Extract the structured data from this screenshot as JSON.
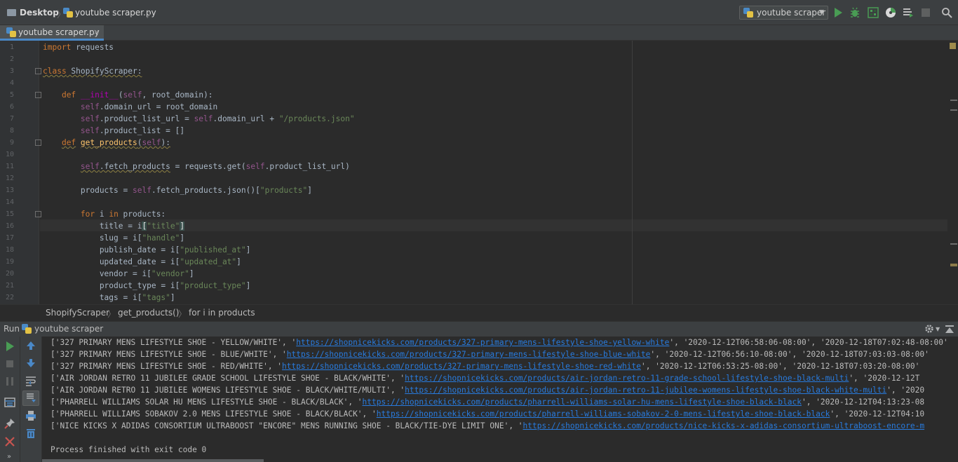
{
  "navbar": {
    "crumbs": [
      "Desktop",
      "youtube scraper.py"
    ],
    "run_config": "youtube scraper",
    "icons": [
      "run-icon",
      "debug-icon",
      "coverage-icon",
      "profile-icon",
      "concurrency-icon",
      "stop-icon",
      "search-icon"
    ]
  },
  "editor_tab": {
    "label": "youtube scraper.py",
    "close": "×"
  },
  "code": {
    "line_numbers": [
      "1",
      "2",
      "3",
      "4",
      "5",
      "6",
      "7",
      "8",
      "9",
      "10",
      "11",
      "12",
      "13",
      "14",
      "15",
      "16",
      "17",
      "18",
      "19",
      "20",
      "21",
      "22"
    ],
    "lines": [
      [
        {
          "t": "import",
          "c": "k"
        },
        {
          "t": " requests"
        }
      ],
      [],
      [
        {
          "t": "class",
          "c": "k wv"
        },
        {
          "t": " ShopifyScraper:",
          "c": "wv"
        }
      ],
      [],
      [
        {
          "t": "    "
        },
        {
          "t": "def",
          "c": "k"
        },
        {
          "t": " "
        },
        {
          "t": "__init__",
          "c": "m"
        },
        {
          "t": "("
        },
        {
          "t": "self",
          "c": "sf"
        },
        {
          "t": ", root_domain):"
        }
      ],
      [
        {
          "t": "        "
        },
        {
          "t": "self",
          "c": "sf"
        },
        {
          "t": ".domain_url = root_domain"
        }
      ],
      [
        {
          "t": "        "
        },
        {
          "t": "self",
          "c": "sf"
        },
        {
          "t": ".product_list_url = "
        },
        {
          "t": "self",
          "c": "sf"
        },
        {
          "t": ".domain_url + "
        },
        {
          "t": "\"/products.json\"",
          "c": "s"
        }
      ],
      [
        {
          "t": "        "
        },
        {
          "t": "self",
          "c": "sf"
        },
        {
          "t": ".product_list = []"
        }
      ],
      [
        {
          "t": "    "
        },
        {
          "t": "def",
          "c": "k wv"
        },
        {
          "t": " "
        },
        {
          "t": "get_products",
          "c": "fn wv"
        },
        {
          "t": "(",
          "c": "wv"
        },
        {
          "t": "self",
          "c": "sf wv"
        },
        {
          "t": "):",
          "c": "wv"
        }
      ],
      [],
      [
        {
          "t": "        "
        },
        {
          "t": "self",
          "c": "sf wv"
        },
        {
          "t": ".fetch_products",
          "c": "wv"
        },
        {
          "t": " = requests.get("
        },
        {
          "t": "self",
          "c": "sf"
        },
        {
          "t": ".product_list_url)"
        }
      ],
      [],
      [
        {
          "t": "        products = "
        },
        {
          "t": "self",
          "c": "sf"
        },
        {
          "t": ".fetch_products.json()["
        },
        {
          "t": "\"products\"",
          "c": "s"
        },
        {
          "t": "]"
        }
      ],
      [],
      [
        {
          "t": "        "
        },
        {
          "t": "for",
          "c": "k"
        },
        {
          "t": " i "
        },
        {
          "t": "in",
          "c": "k"
        },
        {
          "t": " products:"
        }
      ],
      [
        {
          "t": "            title = i"
        },
        {
          "t": "[",
          "c": "bm"
        },
        {
          "t": "\"title\"",
          "c": "s"
        },
        {
          "t": "]",
          "c": "bm"
        }
      ],
      [
        {
          "t": "            slug = i["
        },
        {
          "t": "\"handle\"",
          "c": "s"
        },
        {
          "t": "]"
        }
      ],
      [
        {
          "t": "            publish_date = i["
        },
        {
          "t": "\"published_at\"",
          "c": "s"
        },
        {
          "t": "]"
        }
      ],
      [
        {
          "t": "            updated_date = i["
        },
        {
          "t": "\"updated_at\"",
          "c": "s"
        },
        {
          "t": "]"
        }
      ],
      [
        {
          "t": "            vendor = i["
        },
        {
          "t": "\"vendor\"",
          "c": "s"
        },
        {
          "t": "]"
        }
      ],
      [
        {
          "t": "            product_type = i["
        },
        {
          "t": "\"product_type\"",
          "c": "s"
        },
        {
          "t": "]"
        }
      ],
      [
        {
          "t": "            tags = i["
        },
        {
          "t": "\"tags\"",
          "c": "s"
        },
        {
          "t": "]"
        }
      ]
    ]
  },
  "breadcrumb": {
    "items": [
      "ShopifyScraper",
      "get_products()",
      "for i in products"
    ],
    "separator": "〉"
  },
  "run_panel": {
    "title": "Run",
    "config": "youtube scraper",
    "output": [
      {
        "pre": "['327 PRIMARY MENS LIFESTYLE SHOE - YELLOW/WHITE', '",
        "url": "https://shopnicekicks.com/products/327-primary-mens-lifestyle-shoe-yellow-white",
        "post": "', '2020-12-12T06:58:06-08:00', '2020-12-18T07:02:48-08:00'"
      },
      {
        "pre": "['327 PRIMARY MENS LIFESTYLE SHOE - BLUE/WHITE', '",
        "url": "https://shopnicekicks.com/products/327-primary-mens-lifestyle-shoe-blue-white",
        "post": "', '2020-12-12T06:56:10-08:00', '2020-12-18T07:03:03-08:00'"
      },
      {
        "pre": "['327 PRIMARY MENS LIFESTYLE SHOE - RED/WHITE', '",
        "url": "https://shopnicekicks.com/products/327-primary-mens-lifestyle-shoe-red-white",
        "post": "', '2020-12-12T06:53:25-08:00', '2020-12-18T07:03:20-08:00'"
      },
      {
        "pre": "['AIR JORDAN RETRO 11 JUBILEE GRADE SCHOOL LIFESTYLE SHOE - BLACK/WHITE', '",
        "url": "https://shopnicekicks.com/products/air-jordan-retro-11-grade-school-lifestyle-shoe-black-multi",
        "post": "', '2020-12-12T"
      },
      {
        "pre": "['AIR JORDAN RETRO 11 JUBILEE WOMENS LIFESTYLE SHOE - BLACK/WHITE/MULTI', '",
        "url": "https://shopnicekicks.com/products/air-jordan-retro-11-jubilee-womens-lifestyle-shoe-black-white-multi",
        "post": "', '2020"
      },
      {
        "pre": "['PHARRELL WILLIAMS SOLAR HU MENS LIFESTYLE SHOE - BLACK/BLACK', '",
        "url": "https://shopnicekicks.com/products/pharrell-williams-solar-hu-mens-lifestyle-shoe-black-black",
        "post": "', '2020-12-12T04:13:23-08"
      },
      {
        "pre": "['PHARRELL WILLIAMS SOBAKOV 2.0 MENS LIFESTYLE SHOE - BLACK/BLACK', '",
        "url": "https://shopnicekicks.com/products/pharrell-williams-sobakov-2-0-mens-lifestyle-shoe-black-black",
        "post": "', '2020-12-12T04:10"
      },
      {
        "pre": "['NICE KICKS X ADIDAS CONSORTIUM ULTRABOOST \"ENCORE\" MENS RUNNING SHOE - BLACK/TIE-DYE LIMIT ONE', '",
        "url": "https://shopnicekicks.com/products/nice-kicks-x-adidas-consortium-ultraboost-encore-m",
        "post": ""
      }
    ],
    "exit_message": "Process finished with exit code 0"
  },
  "colors": {
    "run": "#499c54",
    "debug": "#499c54",
    "link": "#287bde",
    "string": "#6a8759",
    "keyword": "#cc7832"
  }
}
